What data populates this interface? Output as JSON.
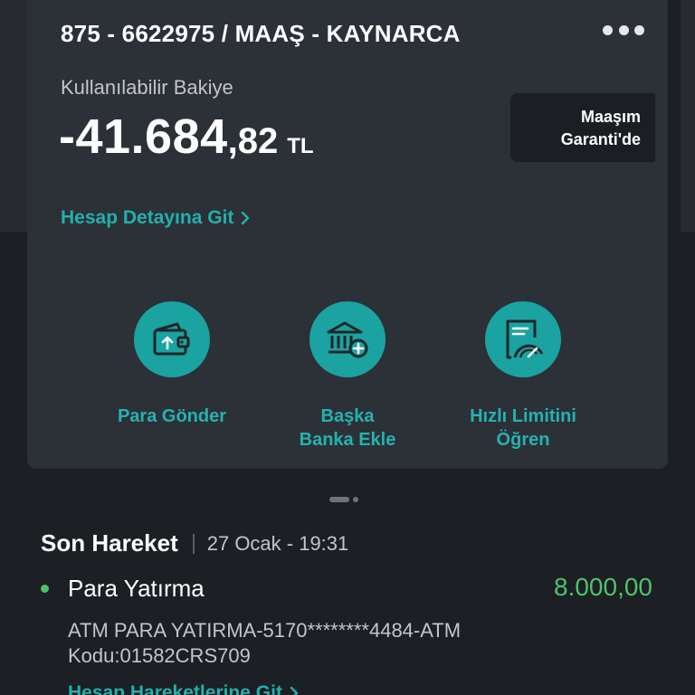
{
  "account": {
    "title": "875 - 6622975 / MAAŞ - KAYNARCA",
    "balance_label": "Kullanılabilir Bakiye",
    "balance_int": "-41.684",
    "balance_dec": ",82",
    "currency": "TL",
    "salary_badge_line1": "Maaşım",
    "salary_badge_line2": "Garanti'de",
    "detail_link": "Hesap Detayına Git"
  },
  "actions": [
    {
      "label": "Para Gönder",
      "icon": "wallet-send-icon"
    },
    {
      "label_line1": "Başka",
      "label_line2": "Banka Ekle",
      "icon": "bank-add-icon"
    },
    {
      "label_line1": "Hızlı Limitini",
      "label_line2": "Öğren",
      "icon": "limit-gauge-icon"
    }
  ],
  "last_transaction": {
    "title": "Son Hareket",
    "date": "27 Ocak - 19:31",
    "name": "Para Yatırma",
    "amount": "8.000,00",
    "description": "ATM PARA YATIRMA-5170********4484-ATM Kodu:01582CRS709",
    "link": "Hesap Hareketlerine Git"
  },
  "colors": {
    "accent": "#1aa3a0",
    "positive": "#4fc26d",
    "card": "#2c3037",
    "background": "#1c1f24"
  }
}
